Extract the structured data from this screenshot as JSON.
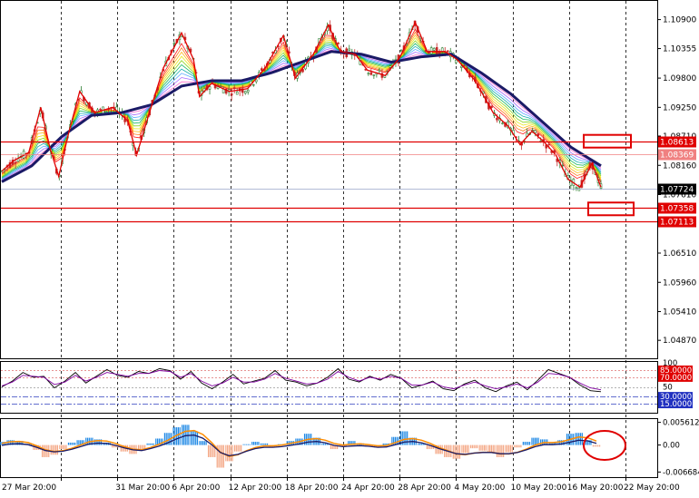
{
  "chart_data": [
    {
      "type": "candlestick",
      "y_ticks": [
        "1.10900",
        "1.10355",
        "1.09800",
        "1.09250",
        "1.08710",
        "1.08160",
        "1.07610",
        "1.07070",
        "1.06510",
        "1.05960",
        "1.05410",
        "1.04870"
      ],
      "ylim": [
        1.046,
        1.112
      ],
      "x_ticks": [
        "27 Mar 20:00",
        "31 Mar 20:00",
        "6 Apr 20:00",
        "12 Apr 20:00",
        "18 Apr 20:00",
        "24 Apr 20:00",
        "28 Apr 20:00",
        "4 May 20:00",
        "10 May 20:00",
        "16 May 20:00",
        "22 May 20:00"
      ],
      "current_price": "1.07724",
      "levels": [
        {
          "label": "1.08613",
          "value": 1.08613,
          "color": "#e00000",
          "weight": "strong"
        },
        {
          "label": "1.08369",
          "value": 1.08369,
          "color": "#f08080",
          "weight": "light"
        },
        {
          "label": "1.07358",
          "value": 1.07358,
          "color": "#e00000",
          "weight": "strong"
        },
        {
          "label": "1.07113",
          "value": 1.07113,
          "color": "#e00000",
          "weight": "strong"
        }
      ],
      "price_path": [
        [
          0,
          1.0805
        ],
        [
          0.02,
          1.0825
        ],
        [
          0.045,
          1.084
        ],
        [
          0.065,
          1.0925
        ],
        [
          0.08,
          1.085
        ],
        [
          0.095,
          1.0795
        ],
        [
          0.11,
          1.087
        ],
        [
          0.13,
          1.0955
        ],
        [
          0.155,
          1.0915
        ],
        [
          0.185,
          1.0925
        ],
        [
          0.21,
          1.09
        ],
        [
          0.225,
          1.0835
        ],
        [
          0.245,
          1.091
        ],
        [
          0.27,
          1.1
        ],
        [
          0.3,
          1.1065
        ],
        [
          0.32,
          1.1015
        ],
        [
          0.33,
          1.0945
        ],
        [
          0.35,
          1.097
        ],
        [
          0.38,
          1.0955
        ],
        [
          0.41,
          1.096
        ],
        [
          0.44,
          1.1
        ],
        [
          0.47,
          1.106
        ],
        [
          0.49,
          1.098
        ],
        [
          0.52,
          1.1025
        ],
        [
          0.545,
          1.108
        ],
        [
          0.565,
          1.103
        ],
        [
          0.59,
          1.1025
        ],
        [
          0.61,
          1.0995
        ],
        [
          0.64,
          1.0985
        ],
        [
          0.665,
          1.102
        ],
        [
          0.69,
          1.1085
        ],
        [
          0.71,
          1.103
        ],
        [
          0.74,
          1.103
        ],
        [
          0.76,
          1.1015
        ],
        [
          0.79,
          1.0975
        ],
        [
          0.82,
          1.0915
        ],
        [
          0.845,
          1.089
        ],
        [
          0.865,
          1.0855
        ],
        [
          0.885,
          1.088
        ],
        [
          0.905,
          1.086
        ],
        [
          0.925,
          1.0835
        ],
        [
          0.945,
          1.079
        ],
        [
          0.965,
          1.0775
        ],
        [
          0.985,
          1.082
        ],
        [
          1.0,
          1.0775
        ]
      ],
      "ema_path": [
        [
          0,
          1.0785
        ],
        [
          0.05,
          1.0815
        ],
        [
          0.1,
          1.087
        ],
        [
          0.15,
          1.091
        ],
        [
          0.2,
          1.0915
        ],
        [
          0.25,
          1.093
        ],
        [
          0.3,
          1.0965
        ],
        [
          0.35,
          1.0975
        ],
        [
          0.4,
          1.0975
        ],
        [
          0.45,
          1.099
        ],
        [
          0.5,
          1.101
        ],
        [
          0.55,
          1.103
        ],
        [
          0.6,
          1.1025
        ],
        [
          0.65,
          1.101
        ],
        [
          0.7,
          1.102
        ],
        [
          0.75,
          1.1025
        ],
        [
          0.8,
          1.099
        ],
        [
          0.85,
          1.095
        ],
        [
          0.9,
          1.09
        ],
        [
          0.95,
          1.085
        ],
        [
          1.0,
          1.0815
        ]
      ]
    },
    {
      "type": "line",
      "y_ticks": [
        "100",
        "85.0000",
        "70.0000",
        "50",
        "30.0000",
        "15.0000"
      ],
      "ylim": [
        0,
        100
      ],
      "levels": [
        85,
        70,
        50,
        30,
        15
      ],
      "series": [
        {
          "color": "#000000",
          "values": [
            50,
            62,
            80,
            70,
            72,
            48,
            62,
            80,
            58,
            72,
            86,
            74,
            70,
            82,
            78,
            88,
            84,
            66,
            82,
            58,
            46,
            60,
            76,
            56,
            62,
            68,
            84,
            64,
            60,
            52,
            58,
            70,
            88,
            66,
            60,
            72,
            64,
            76,
            68,
            48,
            54,
            62,
            46,
            42,
            56,
            64,
            48,
            40,
            52,
            60,
            44,
            64,
            86,
            78,
            70,
            54,
            42,
            40
          ]
        },
        {
          "color": "#8000a0",
          "values": [
            52,
            60,
            74,
            72,
            70,
            55,
            60,
            74,
            62,
            70,
            80,
            76,
            72,
            78,
            78,
            84,
            82,
            70,
            78,
            62,
            52,
            58,
            70,
            60,
            60,
            66,
            78,
            68,
            62,
            56,
            58,
            66,
            82,
            70,
            62,
            70,
            66,
            72,
            68,
            54,
            54,
            60,
            50,
            46,
            54,
            60,
            52,
            46,
            50,
            56,
            48,
            60,
            78,
            76,
            70,
            58,
            48,
            44
          ]
        }
      ]
    },
    {
      "type": "bar",
      "y_ticks": [
        "0.0056125",
        "0.00",
        "-0.0066846"
      ],
      "ylim": [
        -0.0075,
        0.0062
      ],
      "histogram": [
        0.0008,
        0.0012,
        0.001,
        0.0003,
        -0.0012,
        -0.003,
        -0.0024,
        -0.001,
        0.0006,
        0.0012,
        0.0018,
        0.0014,
        0.0006,
        -0.0006,
        -0.0016,
        -0.0022,
        -0.0014,
        0.0004,
        0.0016,
        0.003,
        0.0044,
        0.005,
        0.0034,
        0.001,
        -0.003,
        -0.0056,
        -0.004,
        -0.0016,
        0.0002,
        0.0008,
        0.0004,
        -0.0004,
        0.0002,
        0.001,
        0.0016,
        0.0028,
        0.0018,
        0.0004,
        -0.001,
        -0.0004,
        0.001,
        0.0004,
        -0.0004,
        -0.0006,
        0.0004,
        0.002,
        0.0034,
        0.0018,
        0.0004,
        -0.001,
        -0.0022,
        -0.003,
        -0.0034,
        -0.002,
        -0.0008,
        -0.0014,
        -0.002,
        -0.003,
        -0.0018,
        -0.0006,
        0.0008,
        0.0018,
        0.0014,
        0.0006,
        0.0012,
        0.0028,
        0.003,
        0.0012,
        -0.0004
      ],
      "signal": [
        0.0004,
        0.0008,
        0.0009,
        0.0006,
        -0.0002,
        -0.0012,
        -0.0016,
        -0.0014,
        -0.0008,
        0.0,
        0.0008,
        0.0011,
        0.001,
        0.0004,
        -0.0004,
        -0.001,
        -0.0012,
        -0.0006,
        0.0002,
        0.0012,
        0.0024,
        0.0034,
        0.0036,
        0.0026,
        0.0006,
        -0.0018,
        -0.0028,
        -0.0024,
        -0.0014,
        -0.0006,
        -0.0002,
        -0.0002,
        0.0,
        0.0004,
        0.0008,
        0.0014,
        0.0016,
        0.0012,
        0.0004,
        0.0,
        0.0002,
        0.0003,
        0.0001,
        -0.0002,
        -0.0001,
        0.0006,
        0.0014,
        0.0016,
        0.0012,
        0.0004,
        -0.0006,
        -0.0014,
        -0.0022,
        -0.0024,
        -0.002,
        -0.0018,
        -0.0018,
        -0.0022,
        -0.0022,
        -0.0018,
        -0.001,
        0.0,
        0.0006,
        0.0006,
        0.0008,
        0.0014,
        0.002,
        0.0018,
        0.001
      ]
    }
  ],
  "colors": {
    "bull_candle": "#2e7d32",
    "bear_candle": "#c62828",
    "zigzag": "#e00000",
    "ema": "#1a1a66",
    "hist_pos": "#1e88e5",
    "hist_neg": "#f4a582",
    "signal_line": "#ff8c00",
    "annotation": "#e00000",
    "current_price_box": "#000000"
  },
  "annotations": [
    {
      "shape": "rectangle",
      "panel": "price",
      "near": "1.08613"
    },
    {
      "shape": "rectangle",
      "panel": "price",
      "near": "1.07358"
    },
    {
      "shape": "ellipse",
      "panel": "macd",
      "near": "end of histogram"
    }
  ]
}
